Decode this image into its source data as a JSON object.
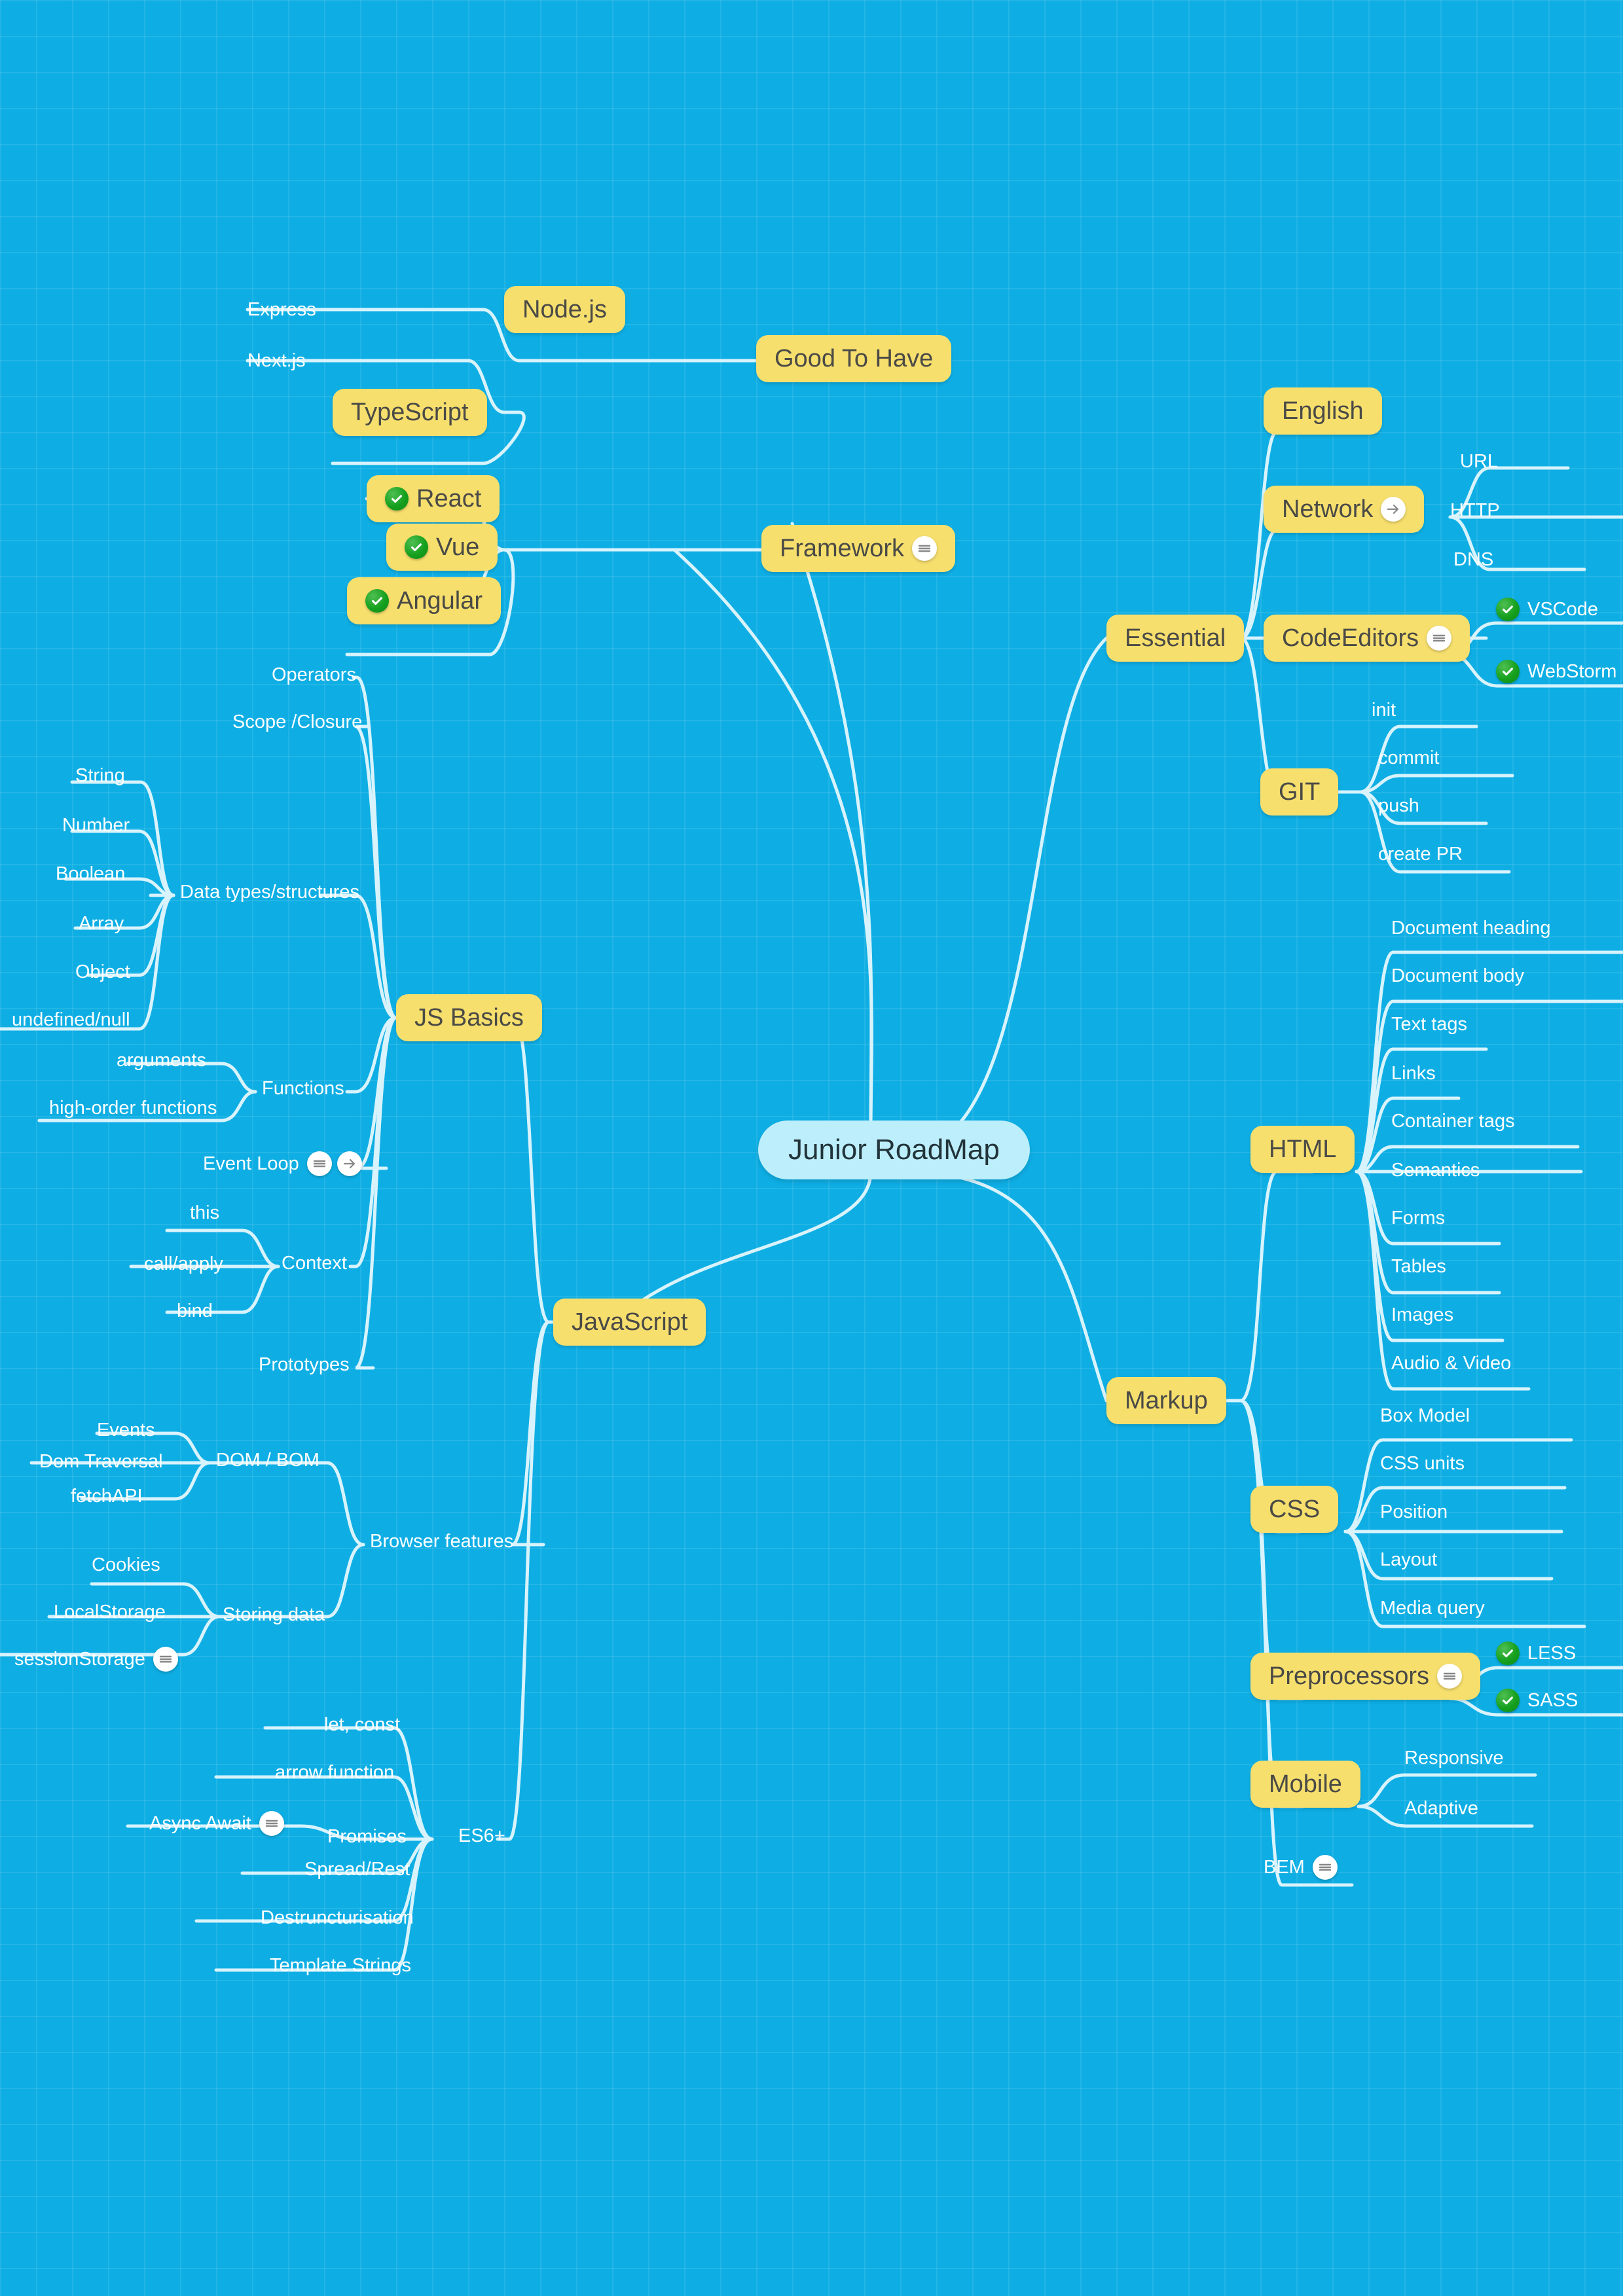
{
  "title": "Junior RoadMap",
  "theme": {
    "background": "#0eaee4",
    "grid_line": "rgba(255,255,255,0.085)",
    "branch_line": "#d8f3fc",
    "node_fill": "#f7df6e",
    "node_text": "#4a4a46",
    "root_fill": "#bdeefb",
    "root_text": "#22343a",
    "plain_text": "#ffffff",
    "check_green": "#16a01e",
    "icon_bg": "#ffffff"
  },
  "root": {
    "label": "Junior RoadMap"
  },
  "branches": {
    "good_to_have": {
      "label": "Good To Have",
      "children": [
        {
          "label": "Node.js",
          "children": [
            {
              "label": "Express"
            },
            {
              "label": "Next.js"
            }
          ]
        },
        {
          "label": "TypeScript"
        }
      ]
    },
    "framework": {
      "label": "Framework",
      "icon": "menu-icon",
      "children": [
        {
          "label": "React",
          "icon": "check-icon"
        },
        {
          "label": "Vue",
          "icon": "check-icon"
        },
        {
          "label": "Angular",
          "icon": "check-icon"
        }
      ]
    },
    "essential": {
      "label": "Essential",
      "children": [
        {
          "label": "English"
        },
        {
          "label": "Network",
          "icon": "arrow-icon",
          "children": [
            {
              "label": "URL"
            },
            {
              "label": "HTTP"
            },
            {
              "label": "DNS"
            }
          ]
        },
        {
          "label": "CodeEditors",
          "icon": "menu-icon",
          "children": [
            {
              "label": "VSCode",
              "icon": "check-icon"
            },
            {
              "label": "WebStorm",
              "icon": "check-icon"
            }
          ]
        },
        {
          "label": "GIT",
          "children": [
            {
              "label": "init"
            },
            {
              "label": "commit"
            },
            {
              "label": "push"
            },
            {
              "label": "create PR"
            }
          ]
        }
      ]
    },
    "markup": {
      "label": "Markup",
      "children": [
        {
          "label": "HTML",
          "children": [
            {
              "label": "Document heading"
            },
            {
              "label": "Document body"
            },
            {
              "label": "Text tags"
            },
            {
              "label": "Links"
            },
            {
              "label": "Container tags"
            },
            {
              "label": "Semantics"
            },
            {
              "label": "Forms"
            },
            {
              "label": "Tables"
            },
            {
              "label": "Images"
            },
            {
              "label": "Audio & Video"
            }
          ]
        },
        {
          "label": "CSS",
          "children": [
            {
              "label": "Box Model"
            },
            {
              "label": "CSS units"
            },
            {
              "label": "Position"
            },
            {
              "label": "Layout"
            },
            {
              "label": "Media query"
            }
          ]
        },
        {
          "label": "Preprocessors",
          "icon": "menu-icon",
          "children": [
            {
              "label": "LESS",
              "icon": "check-icon"
            },
            {
              "label": "SASS",
              "icon": "check-icon"
            }
          ]
        },
        {
          "label": "Mobile",
          "children": [
            {
              "label": "Responsive"
            },
            {
              "label": "Adaptive"
            }
          ]
        },
        {
          "label": "BEM",
          "icon": "menu-icon"
        }
      ]
    },
    "javascript": {
      "label": "JavaScript",
      "children": [
        {
          "label": "JS Basics",
          "children": [
            {
              "label": "Operators"
            },
            {
              "label": "Scope /Closure"
            },
            {
              "label": "Data types/structures",
              "children": [
                {
                  "label": "String"
                },
                {
                  "label": "Number"
                },
                {
                  "label": "Boolean"
                },
                {
                  "label": "Array"
                },
                {
                  "label": "Object"
                },
                {
                  "label": "undefined/null"
                }
              ]
            },
            {
              "label": "Functions",
              "children": [
                {
                  "label": "arguments"
                },
                {
                  "label": "high-order functions"
                }
              ]
            },
            {
              "label": "Event Loop",
              "icon": "menu-icon arrow-icon"
            },
            {
              "label": "Context",
              "children": [
                {
                  "label": "this"
                },
                {
                  "label": "call/apply"
                },
                {
                  "label": "bind"
                }
              ]
            },
            {
              "label": "Prototypes"
            }
          ]
        },
        {
          "label": "Browser features",
          "children": [
            {
              "label": "DOM / BOM",
              "children": [
                {
                  "label": "Events"
                },
                {
                  "label": "Dom Traversal"
                },
                {
                  "label": "fetchAPI"
                }
              ]
            },
            {
              "label": "Storing data",
              "children": [
                {
                  "label": "Cookies"
                },
                {
                  "label": "LocalStorage"
                },
                {
                  "label": "sessionStorage",
                  "icon": "menu-icon"
                }
              ]
            }
          ]
        },
        {
          "label": "ES6+",
          "children": [
            {
              "label": "let, const"
            },
            {
              "label": "arrow function"
            },
            {
              "label": "Promises",
              "children": [
                {
                  "label": "Async Await",
                  "icon": "menu-icon"
                }
              ]
            },
            {
              "label": "Spread/Rest"
            },
            {
              "label": "Destruncturisation"
            },
            {
              "label": "Template Strings"
            }
          ]
        }
      ]
    }
  }
}
